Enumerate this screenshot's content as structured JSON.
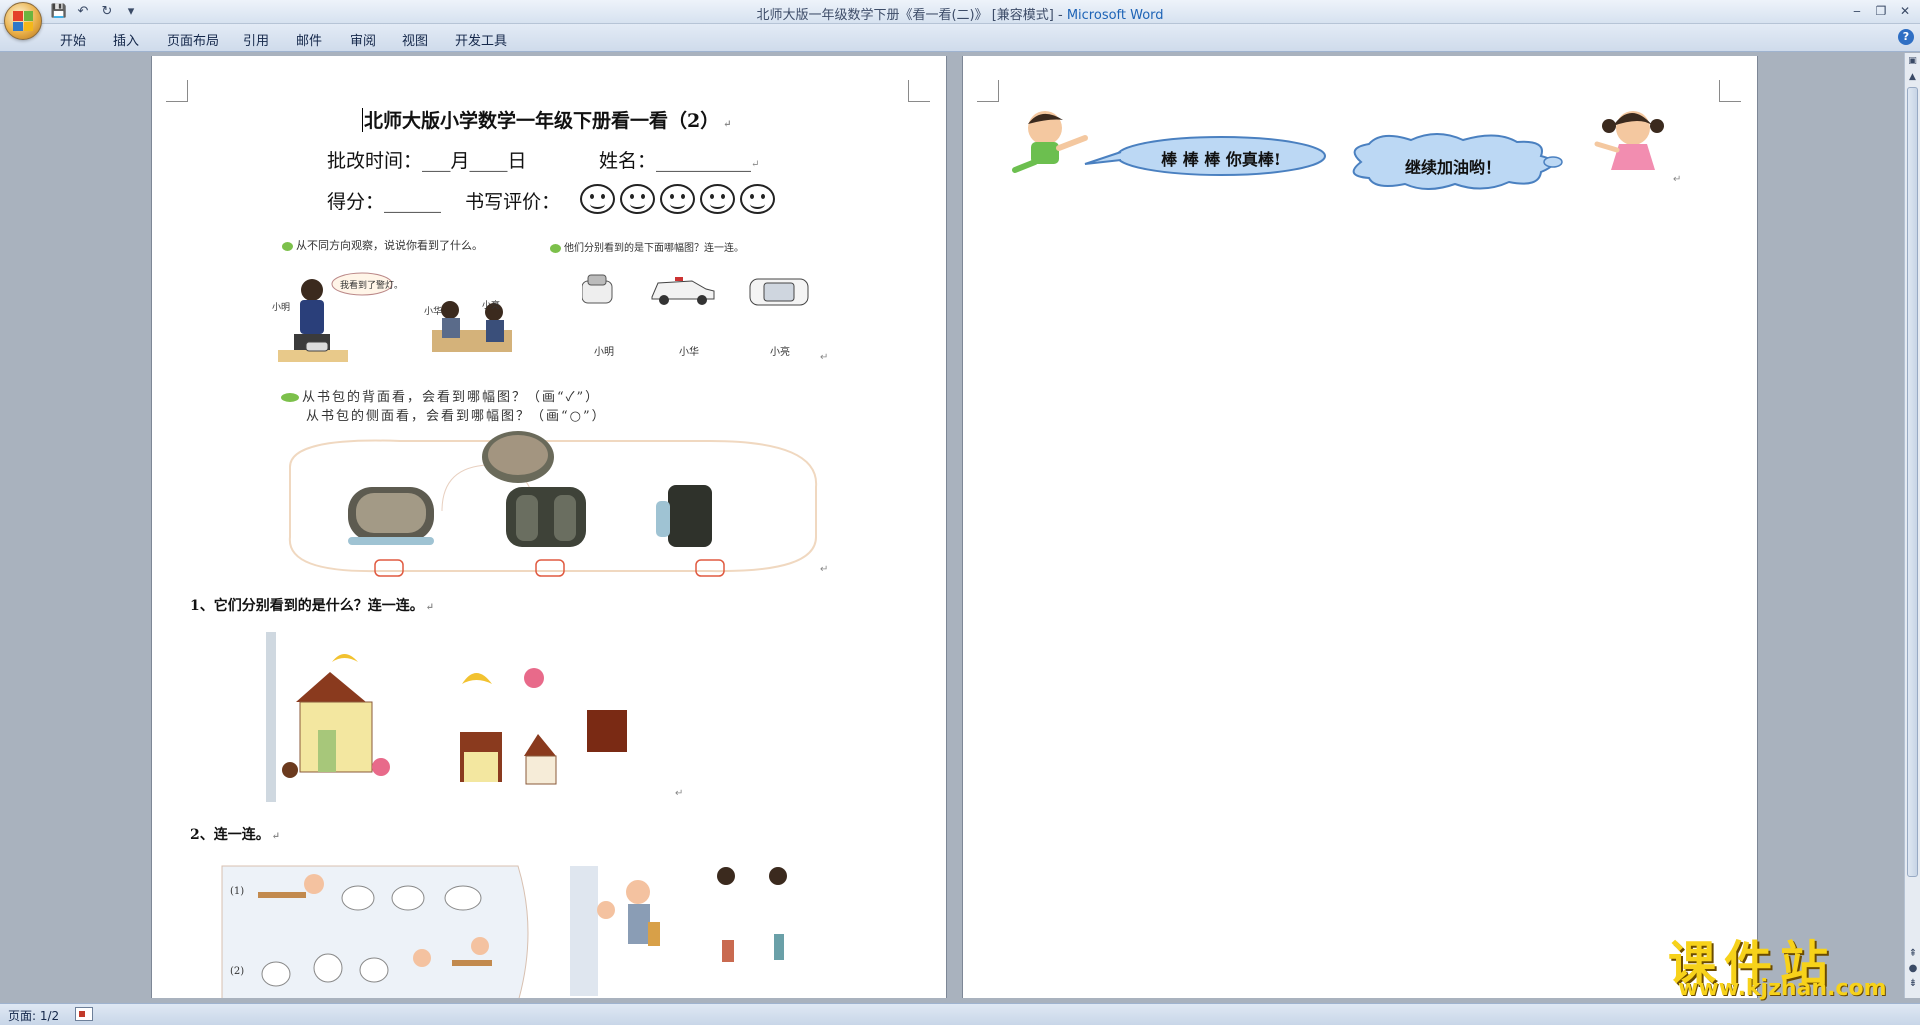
{
  "window": {
    "title": "北师大版一年级数学下册《看一看(二)》 [兼容模式] - ",
    "app_name": "Microsoft Word",
    "minimize": "‒",
    "restore": "❐",
    "close": "✕"
  },
  "ribbon": {
    "tabs": [
      "开始",
      "插入",
      "页面布局",
      "引用",
      "邮件",
      "审阅",
      "视图",
      "开发工具"
    ],
    "help": "?"
  },
  "page1": {
    "title": "北师大版小学数学一年级下册看一看（2）",
    "line2": "批改时间：___月____日            姓名：__________",
    "line3": "得分：______    书写评价：",
    "section_a_caption": "从不同方向观察，说说你看到了什么。",
    "section_a_speech": "我看到了警灯。",
    "section_a_label_1": "小明",
    "section_a_label_2": "小华",
    "section_a_label_3": "小亮",
    "section_b_caption": "他们分别看到的是下面哪幅图？连一连。",
    "section_b_labels": [
      "小明",
      "小华",
      "小亮"
    ],
    "backpack_line1": "从书包的背面看，会看到哪幅图？（画“✓”）",
    "backpack_line2": "从书包的侧面看，会看到哪幅图？（画“○”）",
    "q1": "1、它们分别看到的是什么？连一连。",
    "q2": "2、连一连。",
    "q2_marks": [
      "(1)",
      "(2)"
    ],
    "para_mark": "↵"
  },
  "page2": {
    "bubble_left": "棒 棒 棒 你真棒!",
    "bubble_right": "继续加油哟！"
  },
  "status": {
    "page": "页面: 1/2"
  },
  "watermark": {
    "main": "课件站",
    "url": "www.kjzhan.com"
  }
}
